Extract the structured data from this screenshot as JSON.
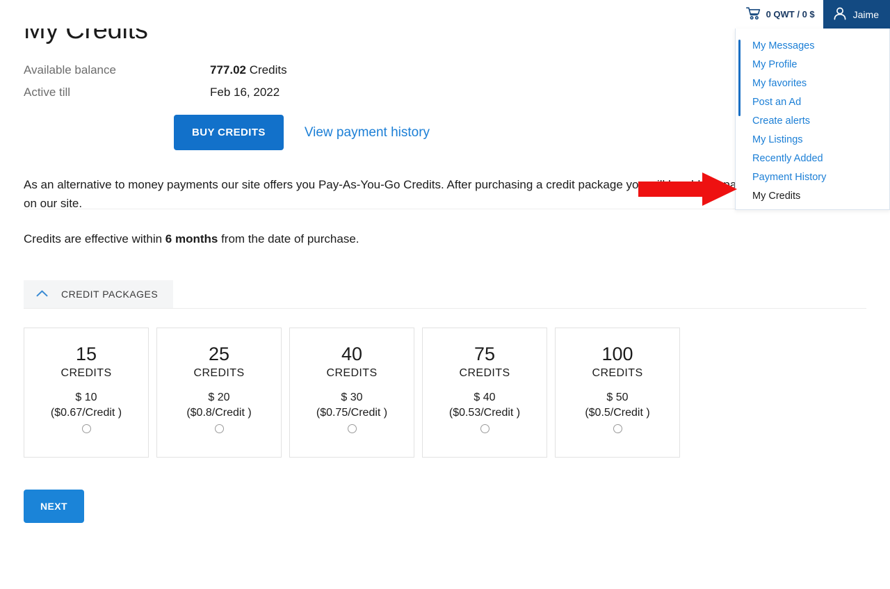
{
  "header": {
    "cart_icon": "shopping-cart-icon",
    "cart_text": "0 QWT / 0 $",
    "user_icon": "user-avatar-icon",
    "user_name": "Jaime"
  },
  "dropdown": {
    "items": [
      {
        "label": "My Messages",
        "active": false
      },
      {
        "label": "My Profile",
        "active": false
      },
      {
        "label": "My favorites",
        "active": false
      },
      {
        "label": "Post an Ad",
        "active": false
      },
      {
        "label": "Create alerts",
        "active": false
      },
      {
        "label": "My Listings",
        "active": false
      },
      {
        "label": "Recently Added",
        "active": false
      },
      {
        "label": "Payment History",
        "active": false
      },
      {
        "label": "My Credits",
        "active": true
      }
    ]
  },
  "annotation": {
    "type": "red-arrow",
    "color": "#EE1111",
    "points_to": "My Credits"
  },
  "main": {
    "title": "My Credits",
    "balance_label": "Available balance",
    "balance_value": "777.02",
    "balance_unit": "Credits",
    "active_till_label": "Active till",
    "active_till_value": "Feb 16, 2022",
    "buy_button": "BUY CREDITS",
    "payment_history_link": "View payment history",
    "intro_paragraph": "As an alternative to money payments our site offers you Pay-As-You-Go Credits. After purchasing a credit package you will be able to pay for different services on our site.",
    "validity_prefix": "Credits are effective within ",
    "validity_bold": "6 months",
    "validity_suffix": " from the date of purchase.",
    "section_tab_label": "CREDIT PACKAGES",
    "section_tab_icon": "chevron-up-icon",
    "next_button": "NEXT"
  },
  "packages": [
    {
      "amount": "15",
      "unit": "CREDITS",
      "price": "$ 10",
      "rate": "($0.67/Credit )",
      "selected": false
    },
    {
      "amount": "25",
      "unit": "CREDITS",
      "price": "$ 20",
      "rate": "($0.8/Credit )",
      "selected": false
    },
    {
      "amount": "40",
      "unit": "CREDITS",
      "price": "$ 30",
      "rate": "($0.75/Credit )",
      "selected": false
    },
    {
      "amount": "75",
      "unit": "CREDITS",
      "price": "$ 40",
      "rate": "($0.53/Credit )",
      "selected": false
    },
    {
      "amount": "100",
      "unit": "CREDITS",
      "price": "$ 50",
      "rate": "($0.5/Credit )",
      "selected": false
    }
  ],
  "colors": {
    "brand_dark": "#134A82",
    "brand_blue": "#1271CA",
    "link_blue": "#1C7FD6",
    "accent_red": "#EE1111"
  }
}
